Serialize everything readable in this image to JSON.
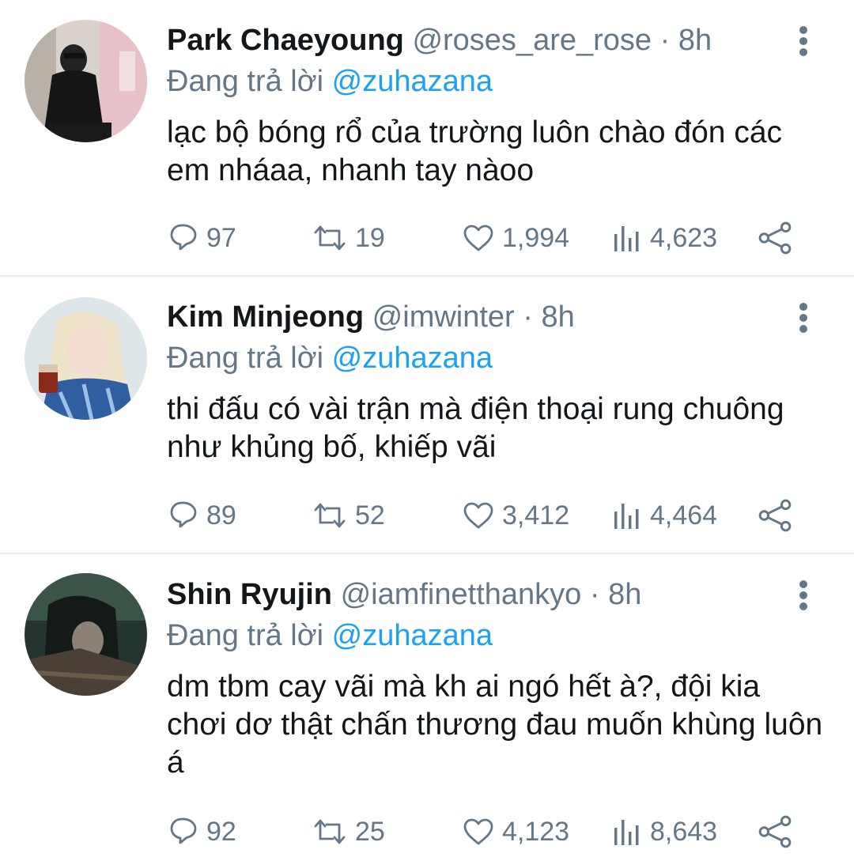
{
  "tweets": [
    {
      "display_name": "Park Chaeyoung",
      "handle": "@roses_are_rose",
      "separator": "·",
      "time": "8h",
      "reply_prefix": "Đang trả lời",
      "reply_to": "@zuhazana",
      "text": "lạc bộ bóng rổ của trường luôn chào đón các em nháaa, nhanh tay nàoo",
      "replies": "97",
      "retweets": "19",
      "likes": "1,994",
      "views": "4,623"
    },
    {
      "display_name": "Kim Minjeong",
      "handle": "@imwinter",
      "separator": "·",
      "time": "8h",
      "reply_prefix": "Đang trả lời",
      "reply_to": "@zuhazana",
      "text": "thi đấu có vài trận mà điện thoại rung chuông như khủng bố, khiếp vãi",
      "replies": "89",
      "retweets": "52",
      "likes": "3,412",
      "views": "4,464"
    },
    {
      "display_name": "Shin Ryujin",
      "handle": "@iamfinetthankyo",
      "separator": "·",
      "time": "8h",
      "reply_prefix": "Đang trả lời",
      "reply_to": "@zuhazana",
      "text": "dm tbm cay vãi mà kh ai ngó hết à?, đội kia chơi dơ thật chấn thương đau muốn khùng luôn á",
      "replies": "92",
      "retweets": "25",
      "likes": "4,123",
      "views": "8,643"
    }
  ],
  "icons": {
    "reply": "reply-icon",
    "retweet": "retweet-icon",
    "like": "heart-icon",
    "views": "views-icon",
    "share": "share-icon",
    "more": "more-vertical-icon"
  },
  "colors": {
    "text": "#14171a",
    "secondary": "#657786",
    "link": "#1da1f2",
    "divider": "#e6ecf0"
  }
}
